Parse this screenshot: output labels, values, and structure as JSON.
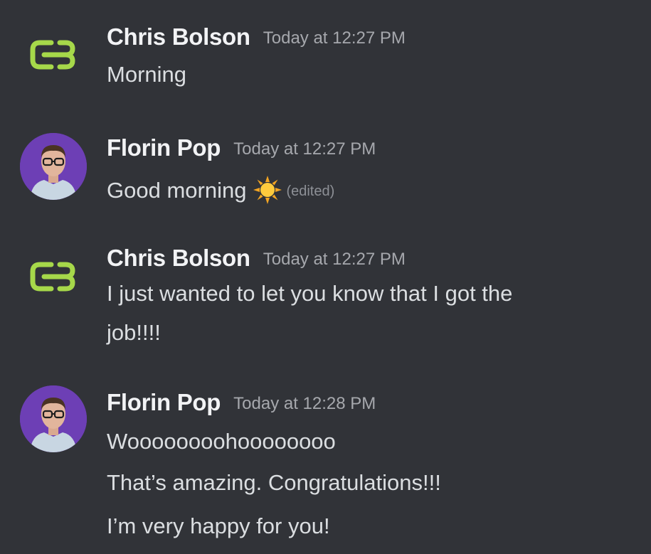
{
  "messages": [
    {
      "author": "Chris Bolson",
      "timestamp": "Today at 12:27 PM",
      "avatar_icon": "cb-logo-icon",
      "lines": [
        "Morning"
      ]
    },
    {
      "author": "Florin Pop",
      "timestamp": "Today at 12:27 PM",
      "avatar_icon": "profile-photo",
      "lines": [
        "Good morning"
      ],
      "emoji": "sun-emoji-icon",
      "edited": "(edited)"
    },
    {
      "author": "Chris Bolson",
      "timestamp": "Today at 12:27 PM",
      "avatar_icon": "cb-logo-icon",
      "lines": [
        "I just wanted to let you know that I got the",
        "job!!!!"
      ]
    },
    {
      "author": "Florin Pop",
      "timestamp": "Today at 12:28 PM",
      "avatar_icon": "profile-photo",
      "lines": [
        "Woooooooohoooooooo",
        "That’s amazing. Congratulations!!!",
        "I’m very happy for you!"
      ]
    }
  ],
  "colors": {
    "background": "#313338",
    "author": "#f2f3f5",
    "timestamp": "#a6a8ad",
    "text": "#dbdee1",
    "logo_green": "#a6d84a",
    "avatar_purple": "#6d3fb5"
  }
}
